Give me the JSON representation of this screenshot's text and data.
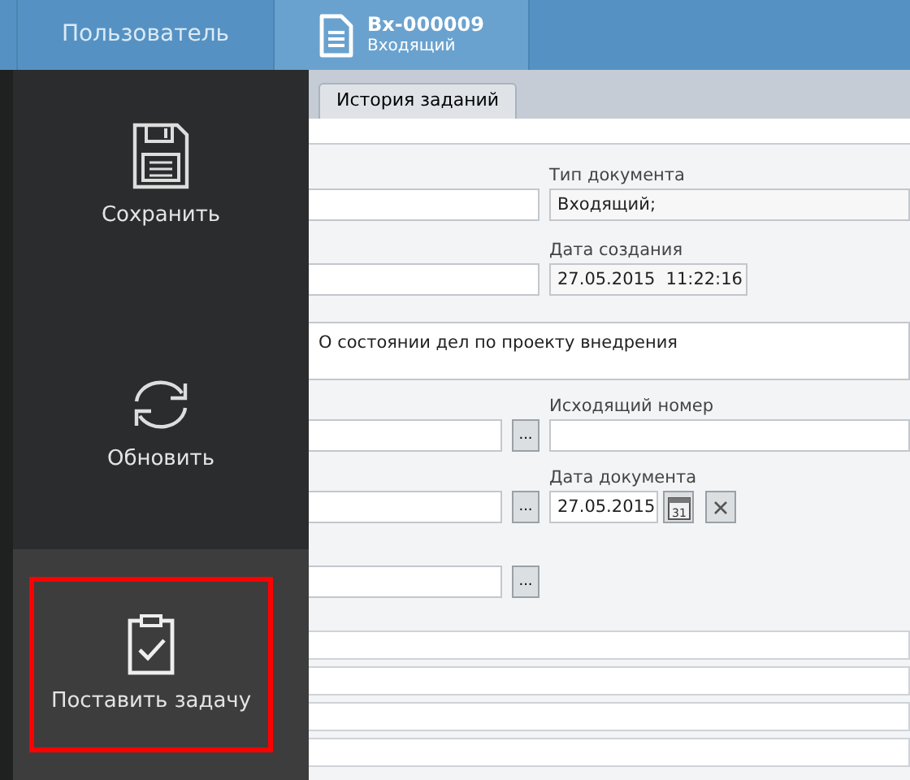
{
  "header_tabs": [
    {
      "kind": "text",
      "label": "Пользователь",
      "selected": false
    },
    {
      "kind": "document",
      "title": "Вх-000009",
      "subtitle": "Входящий",
      "selected": true
    }
  ],
  "document_tabs": [
    {
      "label": "История заданий",
      "selected": true
    }
  ],
  "form": {
    "document_type": {
      "label": "Тип документа",
      "value": "Входящий;"
    },
    "created": {
      "label": "Дата создания",
      "value": "27.05.2015  11:22:16"
    },
    "description": {
      "value": "О состоянии дел по проекту внедрения"
    },
    "outgoing_number": {
      "label": "Исходящий номер"
    },
    "document_date": {
      "label": "Дата документа",
      "value": "27.05.2015",
      "calendar_day": "31"
    },
    "picker_buttons": [
      "...",
      "...",
      "..."
    ]
  },
  "action_panel": {
    "buttons": [
      {
        "kind": "save",
        "label": "Сохранить",
        "highlighted": false
      },
      {
        "kind": "refresh",
        "label": "Обновить",
        "highlighted": false
      },
      {
        "kind": "task",
        "label": "Поставить задачу",
        "highlighted": true
      }
    ]
  }
}
